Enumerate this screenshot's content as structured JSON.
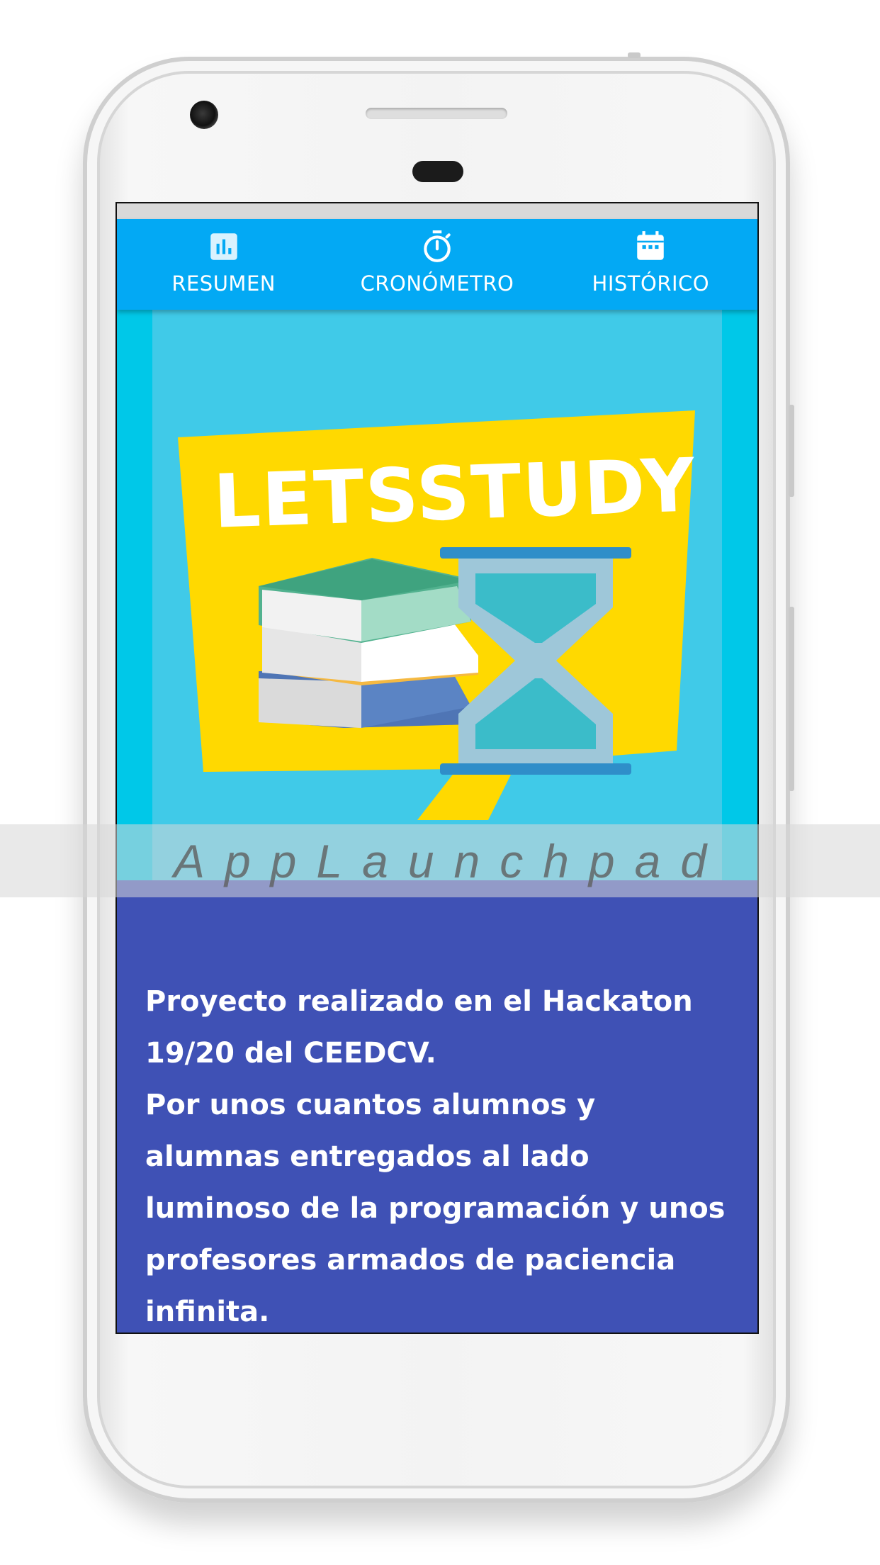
{
  "tabs": [
    {
      "label": "RESUMEN",
      "icon": "bar-chart-icon"
    },
    {
      "label": "CRONÓMETRO",
      "icon": "stopwatch-icon"
    },
    {
      "label": "HISTÓRICO",
      "icon": "calendar-icon"
    }
  ],
  "hero": {
    "logo_text": "LETSSTUDY"
  },
  "description": {
    "paragraph1": "Proyecto realizado en el Hackaton 19/20 del CEEDCV.",
    "paragraph2": "Por unos cuantos alumnos y alumnas entregados al lado luminoso de la programación y unos profesores armados de paciencia infinita."
  },
  "watermark": "AppLaunchpad",
  "colors": {
    "tabbar": "#03a9f4",
    "content_background": "#3f51b5",
    "hero_background": "#40cae8",
    "speech_bubble": "#ffd900"
  }
}
